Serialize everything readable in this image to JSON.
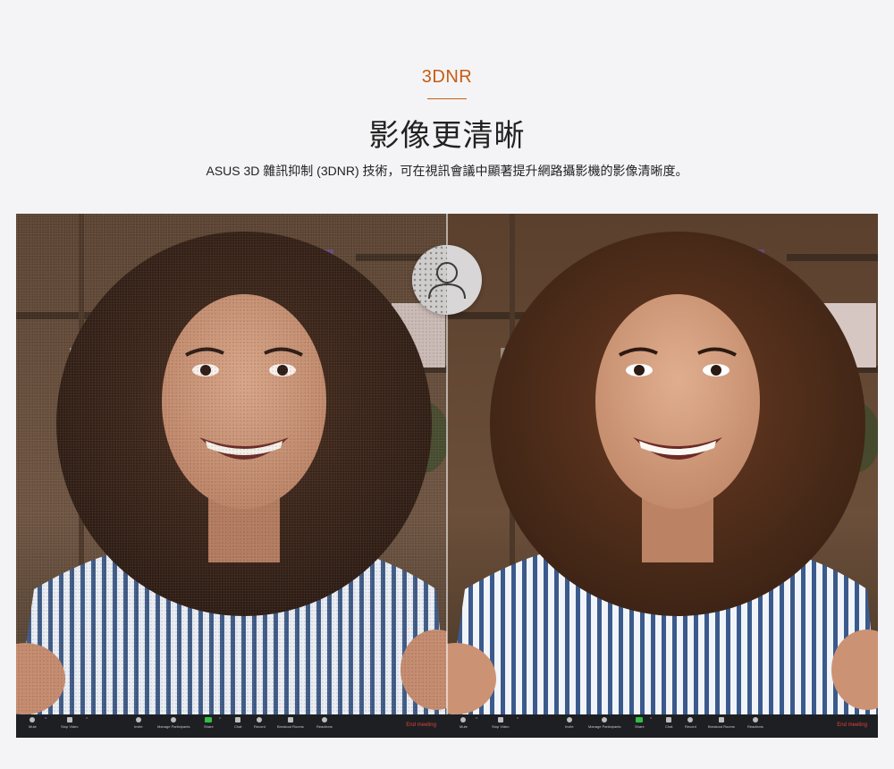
{
  "header": {
    "eyebrow": "3DNR",
    "title": "影像更清晰",
    "subtitle": "ASUS 3D 雜訊抑制 (3DNR) 技術，可在視訊會議中顯著提升網路攝影機的影像清晰度。"
  },
  "compare": {
    "handle_icon": "user-icon"
  },
  "toolbar": {
    "items": [
      "Mute",
      "Stop Video",
      "Invite",
      "Manage Participants",
      "Share",
      "Chat",
      "Record",
      "Breakout Rooms",
      "Reactions"
    ],
    "end_label": "End meeting",
    "end_color": "#e0423a",
    "share_color": "#2fbf46"
  },
  "colors": {
    "accent": "#c65d14",
    "background": "#f4f4f6"
  }
}
